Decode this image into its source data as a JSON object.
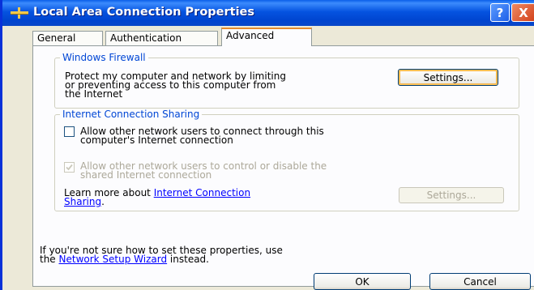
{
  "window": {
    "title": "Local Area Connection Properties",
    "help_label": "?",
    "close_label": "X"
  },
  "tabs": [
    {
      "label": "General",
      "active": false
    },
    {
      "label": "Authentication",
      "active": false
    },
    {
      "label": "Advanced",
      "active": true
    }
  ],
  "firewall": {
    "legend": "Windows Firewall",
    "description_lines": [
      "Protect my computer and network by limiting",
      "or preventing access to this computer from",
      "the Internet"
    ],
    "settings_label": "Settings..."
  },
  "ics": {
    "legend": "Internet Connection Sharing",
    "allow_connect_lines": [
      "Allow other network users to connect through this",
      "computer's Internet connection"
    ],
    "allow_connect_checked": false,
    "allow_control_lines": [
      "Allow other network users to control or disable the",
      "shared Internet connection"
    ],
    "allow_control_checked": true,
    "allow_control_enabled": false,
    "learn_more_prefix": "Learn more about ",
    "learn_more_link_line1": "Internet Connection",
    "learn_more_link_line2": "Sharing",
    "learn_more_suffix": ".",
    "settings_label": "Settings...",
    "settings_enabled": false
  },
  "footer": {
    "line1": "If you're not sure how to set these properties, use",
    "line2_prefix": "the ",
    "wizard_link": "Network Setup Wizard",
    "line2_suffix": " instead."
  },
  "buttons": {
    "ok": "OK",
    "cancel": "Cancel"
  },
  "colors": {
    "title_bar": "#0553e0",
    "legend_text": "#0046d5",
    "active_tab_accent": "#e68b2c",
    "link": "#0000ff",
    "disabled_text": "#aca899"
  }
}
